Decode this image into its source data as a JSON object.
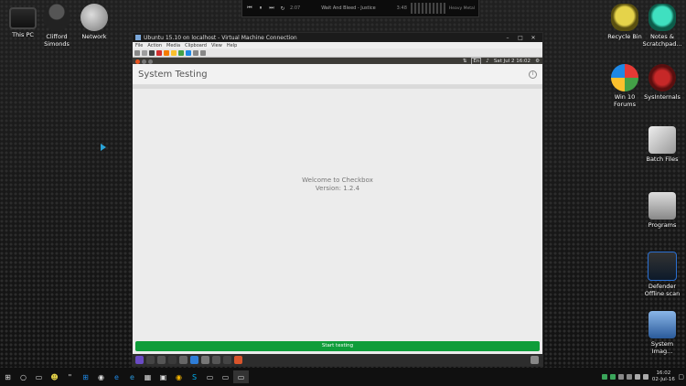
{
  "desktop": {
    "icons_left": [
      {
        "label": "This PC"
      },
      {
        "label": "Clifford\nSimonds"
      },
      {
        "label": "Network"
      }
    ],
    "icons_right": [
      {
        "label": "Recycle Bin"
      },
      {
        "label": "Notes &\nScratchpad..."
      },
      {
        "label": "Win 10\nForums"
      },
      {
        "label": "SysInternals"
      },
      {
        "label": "Batch Files"
      },
      {
        "label": "Programs"
      },
      {
        "label": "Defender\nOffline scan"
      },
      {
        "label": "System\nImag..."
      }
    ]
  },
  "media_player": {
    "track": "Wait And Bleed - Justice",
    "time_left": "2:07",
    "time_right": "3:48",
    "status": "Heavy Metal"
  },
  "vm": {
    "title": "Ubuntu 15.10 on localhost - Virtual Machine Connection",
    "menu": [
      "File",
      "Action",
      "Media",
      "Clipboard",
      "View",
      "Help"
    ],
    "topbar_clock": "Sat Jul 2 16:02",
    "topbar_lang": "En"
  },
  "checkbox": {
    "title": "System Testing",
    "info_icon": "i",
    "welcome": "Welcome to Checkbox",
    "version": "Version: 1.2.4",
    "start_button": "Start testing"
  },
  "taskbar": {
    "clock_time": "16:02",
    "clock_date": "02-Jul-16"
  },
  "colors": {
    "start_button": "#0f9d3a",
    "ubuntu_topbar": "#3c3b37",
    "app_bg": "#ececec"
  }
}
